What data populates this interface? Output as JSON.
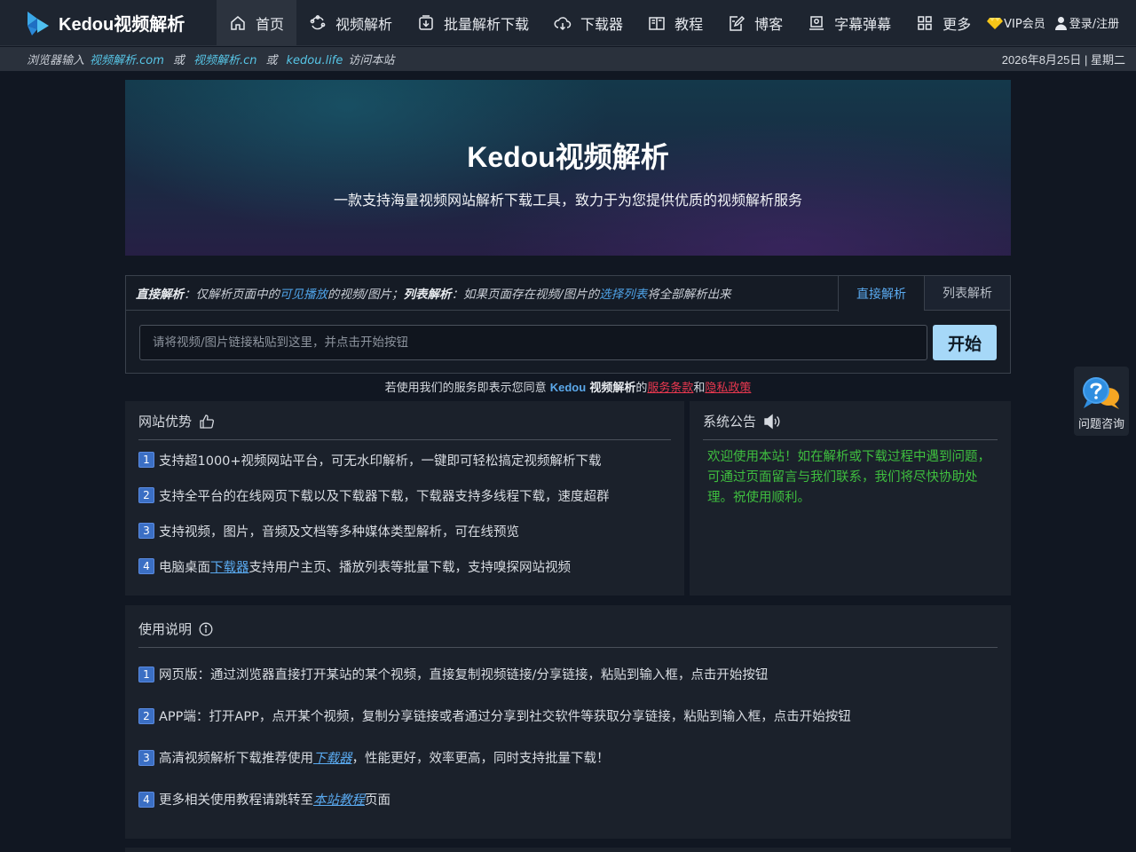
{
  "brand": {
    "name": "Kedou视频解析"
  },
  "nav": {
    "items": [
      {
        "label": "首页",
        "icon": "home-icon",
        "active": true
      },
      {
        "label": "视频解析",
        "icon": "sync-icon"
      },
      {
        "label": "批量解析下载",
        "icon": "batch-download-icon"
      },
      {
        "label": "下载器",
        "icon": "cloud-download-icon"
      },
      {
        "label": "教程",
        "icon": "book-icon"
      },
      {
        "label": "博客",
        "icon": "edit-icon"
      },
      {
        "label": "字幕弹幕",
        "icon": "subtitle-icon"
      },
      {
        "label": "更多",
        "icon": "grid-icon"
      }
    ],
    "vip_label": "VIP会员",
    "login_label": "登录/注册"
  },
  "infobar": {
    "prefix": "浏览器输入",
    "domain1": "视频解析.com",
    "or1": "或",
    "domain2": "视频解析.cn",
    "or2": "或",
    "domain3": "kedou.life",
    "suffix": "访问本站",
    "date": "2026年8月25日 | 星期二"
  },
  "hero": {
    "title": "Kedou视频解析",
    "subtitle": "一款支持海量视频网站解析下载工具，致力于为您提供优质的视频解析服务"
  },
  "parse": {
    "desc": {
      "direct_title": "直接解析",
      "direct_text1": "：仅解析页面中的",
      "direct_highlight": "可见播放",
      "direct_text2": "的视频/图片；",
      "list_title": "列表解析",
      "list_text1": "：如果页面存在视频/图片的",
      "list_highlight": "选择列表",
      "list_text2": "将全部解析出来"
    },
    "tabs": {
      "direct": "直接解析",
      "list": "列表解析"
    },
    "input_placeholder": "请将视频/图片链接粘贴到这里，并点击开始按钮",
    "start_label": "开始"
  },
  "terms": {
    "prefix": "若使用我们的服务即表示您同意",
    "brand": "Kedou",
    "brand_suffix": "视频解析",
    "of": "的",
    "service": "服务条款",
    "and": "和",
    "privacy": "隐私政策"
  },
  "advantages": {
    "title": "网站优势",
    "items": [
      {
        "num": "1",
        "text": "支持超1000+视频网站平台，可无水印解析，一键即可轻松搞定视频解析下载"
      },
      {
        "num": "2",
        "text": "支持全平台的在线网页下载以及下载器下载，下载器支持多线程下载，速度超群"
      },
      {
        "num": "3",
        "text": "支持视频，图片，音频及文档等多种媒体类型解析，可在线预览"
      },
      {
        "num": "4",
        "text_before": "电脑桌面",
        "link": "下载器",
        "text_after": "支持用户主页、播放列表等批量下载，支持嗅探网站视频"
      }
    ]
  },
  "notice": {
    "title": "系统公告",
    "text": "欢迎使用本站！如在解析或下载过程中遇到问题，可通过页面留言与我们联系，我们将尽快协助处理。祝使用顺利。"
  },
  "usage": {
    "title": "使用说明",
    "items": [
      {
        "num": "1",
        "text": "网页版：通过浏览器直接打开某站的某个视频，直接复制视频链接/分享链接，粘贴到输入框，点击开始按钮"
      },
      {
        "num": "2",
        "text": "APP端：打开APP，点开某个视频，复制分享链接或者通过分享到社交软件等获取分享链接，粘贴到输入框，点击开始按钮"
      },
      {
        "num": "3",
        "text_before": "高清视频解析下载推荐使用",
        "link": "下载器",
        "text_after": "，性能更好，效率更高，同时支持批量下载！"
      },
      {
        "num": "4",
        "text_before": "更多相关使用教程请跳转至",
        "link": " 本站教程 ",
        "text_after": "页面"
      }
    ]
  },
  "help": {
    "label": "问题咨询"
  },
  "colors": {
    "background": "#111722",
    "nav": "#1e2530",
    "accent": "#5aaaf0",
    "start_button": "#a6d8f8",
    "notice_text": "#3fbf3f",
    "terms_link": "#e8384f"
  }
}
